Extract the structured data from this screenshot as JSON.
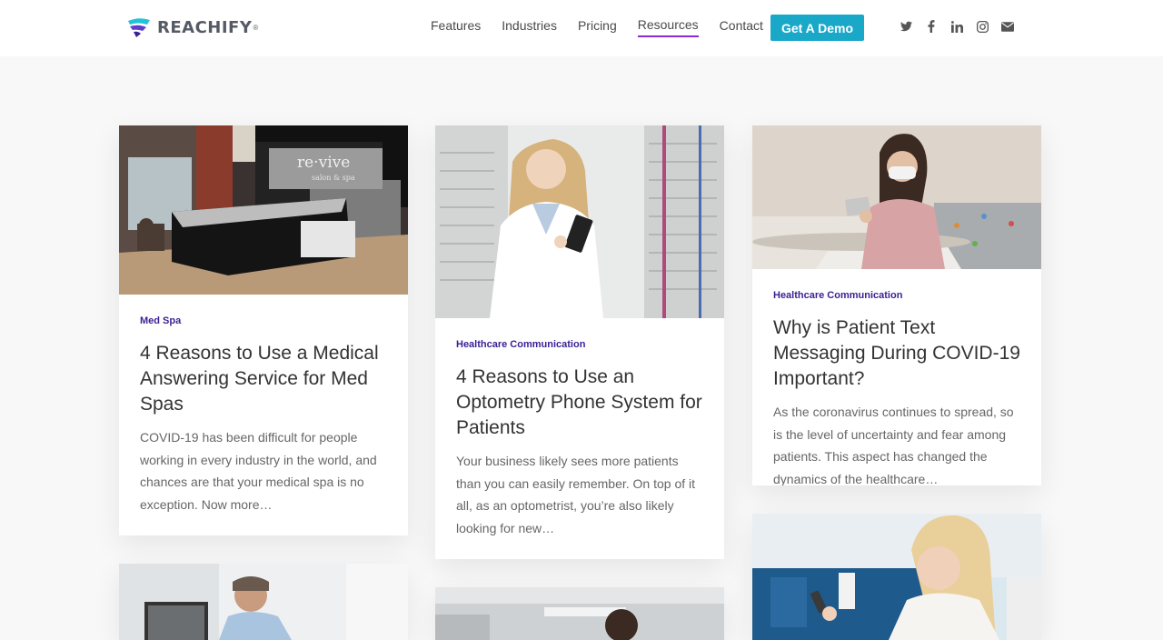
{
  "header": {
    "logo_text": "REACHIFY",
    "logo_reg": "®",
    "nav": [
      "Features",
      "Industries",
      "Pricing",
      "Resources",
      "Contact"
    ],
    "active_nav": "Resources",
    "cta": "Get A Demo",
    "social_icons": [
      "twitter-icon",
      "facebook-icon",
      "linkedin-icon",
      "instagram-icon",
      "email-icon"
    ]
  },
  "posts": [
    {
      "category": "Med Spa",
      "title": "4 Reasons to Use a Medical Answering Service for Med Spas",
      "excerpt": "COVID-19 has been difficult for people working in every industry in the world, and chances are that your medical spa is no exception. Now more…",
      "image_sign": "re·vive",
      "image_sign_sub": "salon & spa"
    },
    {
      "category": "Healthcare Communication",
      "title": "4 Reasons to Use an Optometry Phone System for Patients",
      "excerpt": "Your business likely sees more patients than you can easily remember. On top of it all, as an optometrist, you’re also likely looking for new…"
    },
    {
      "category": "Healthcare Communication",
      "title": "Why is Patient Text Messaging During COVID-19 Important?",
      "excerpt": "As the coronavirus continues to spread, so is the level of uncertainty and fear among patients. This aspect has changed the dynamics of the healthcare…"
    }
  ],
  "colors": {
    "accent": "#1aa8c9",
    "category": "#3a1f94",
    "active_underline": "#8b2bd6"
  }
}
